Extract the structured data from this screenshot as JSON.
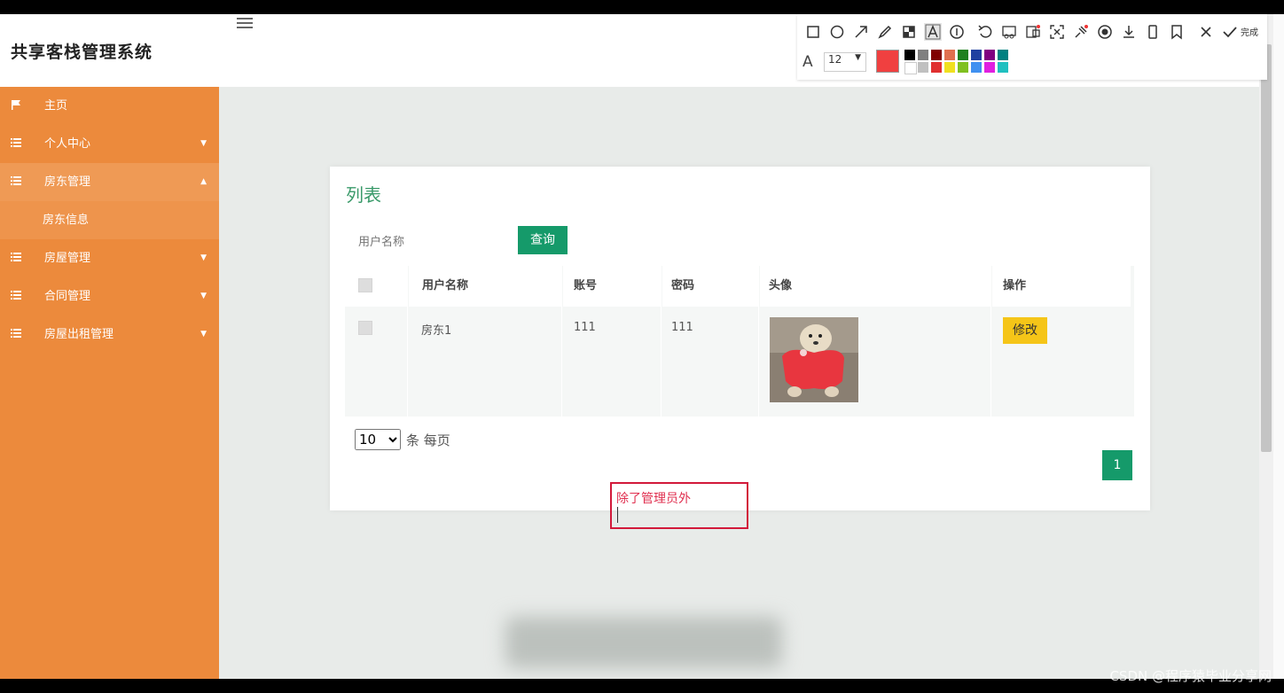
{
  "app": {
    "title": "共享客栈管理系统"
  },
  "sidebar": {
    "items": [
      {
        "label": "主页",
        "icon": "flag-icon",
        "has_arrow": false
      },
      {
        "label": "个人中心",
        "icon": "list-icon",
        "has_arrow": true
      },
      {
        "label": "房东管理",
        "icon": "list-icon",
        "has_arrow": true,
        "expanded": true
      },
      {
        "label": "房屋管理",
        "icon": "list-icon",
        "has_arrow": true
      },
      {
        "label": "合同管理",
        "icon": "list-icon",
        "has_arrow": true
      },
      {
        "label": "房屋出租管理",
        "icon": "list-icon",
        "has_arrow": true
      }
    ],
    "subitem": "房东信息"
  },
  "panel": {
    "title": "列表",
    "search": {
      "placeholder": "用户名称",
      "button": "查询"
    },
    "table": {
      "headers": [
        "用户名称",
        "账号",
        "密码",
        "头像",
        "操作"
      ],
      "rows": [
        {
          "username": "房东1",
          "account": "111",
          "password": "111",
          "action": "修改"
        }
      ]
    },
    "pagination": {
      "page_size": "10",
      "page_size_label": "条 每页",
      "current_page": "1"
    }
  },
  "annotation": {
    "text": "除了管理员外"
  },
  "toolbar": {
    "tools": [
      "rectangle-icon",
      "circle-icon",
      "arrow-icon",
      "pen-icon",
      "mosaic-icon",
      "text-icon",
      "number-icon",
      "undo-icon",
      "cut-icon",
      "ocr-icon",
      "expand-icon",
      "pin-icon",
      "record-icon",
      "download-icon",
      "phone-icon",
      "bookmark-icon",
      "close-icon",
      "check-icon"
    ],
    "done_label": "完成",
    "font_size": "12",
    "current_color": "#f04040",
    "palette": [
      "#000000",
      "#808080",
      "#800000",
      "#e07050",
      "#208020",
      "#2040a0",
      "#800080",
      "#008080",
      "#ffffff",
      "#c0c0c0",
      "#e03030",
      "#f0e020",
      "#80c020",
      "#4090f0",
      "#e020e0",
      "#20c0c0"
    ]
  },
  "colors": {
    "sidebar": "#ec8a3c",
    "accent": "#159a6a",
    "edit_button": "#f5c518"
  },
  "watermark": "CSDN @程序猿毕业分享网"
}
